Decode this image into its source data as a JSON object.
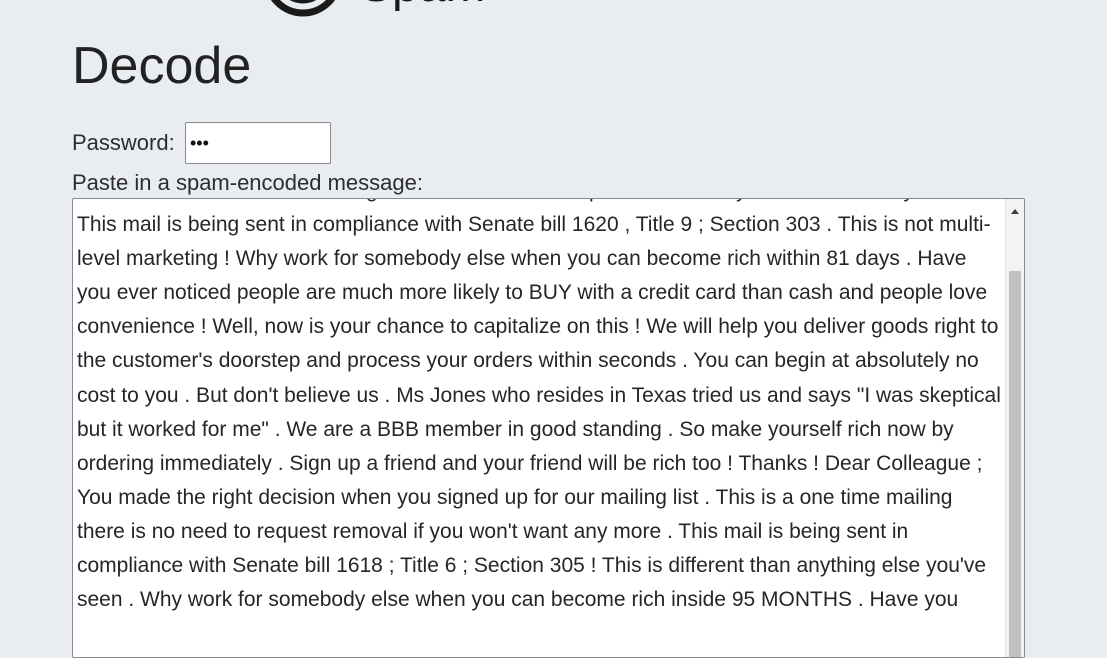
{
  "header": {
    "logo_text": "Spam"
  },
  "page": {
    "title": "Decode"
  },
  "form": {
    "password_label": "Password:",
    "password_value": "abc",
    "message_label": "Paste in a spam-encoded message:",
    "message_text": "letter ! This is a one time mailing there is no need to request removal if you won't want any more ! This mail is being sent in compliance with Senate bill 1620 , Title 9 ; Section 303 . This is not multi-level marketing ! Why work for somebody else when you can become rich within 81 days . Have you ever noticed people are much more likely to BUY with a credit card than cash and people love convenience ! Well, now is your chance to capitalize on this ! We will help you deliver goods right to the customer's doorstep and process your orders within seconds . You can begin at absolutely no cost to you . But don't believe us . Ms Jones who resides in Texas tried us and says \"I was skeptical but it worked for me\" . We are a BBB member in good standing . So make yourself rich now by ordering immediately . Sign up a friend and your friend will be rich too ! Thanks ! Dear Colleague ; You made the right decision when you signed up for our mailing list . This is a one time mailing there is no need to request removal if you won't want any more . This mail is being sent in compliance with Senate bill 1618 ; Title 6 ; Section 305 ! This is different than anything else you've seen . Why work for somebody else when you can become rich inside 95 MONTHS . Have you"
  }
}
